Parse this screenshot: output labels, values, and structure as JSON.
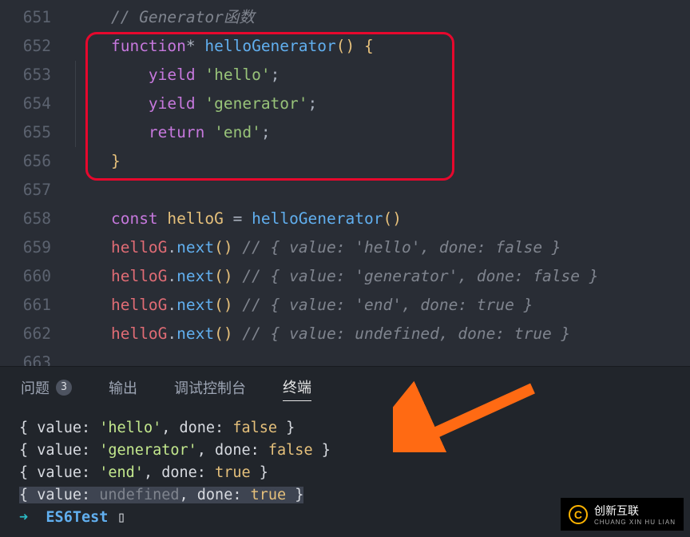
{
  "editor": {
    "lines": [
      {
        "num": "651",
        "tokens": [
          [
            "    ",
            ""
          ],
          [
            "// Generator函数",
            "c-comment"
          ]
        ]
      },
      {
        "num": "652",
        "tokens": [
          [
            "    ",
            ""
          ],
          [
            "function",
            "c-keyword"
          ],
          [
            "* ",
            "c-default"
          ],
          [
            "helloGenerator",
            "c-func"
          ],
          [
            "() ",
            "c-brace"
          ],
          [
            "{",
            "c-brace"
          ]
        ]
      },
      {
        "num": "653",
        "guide": true,
        "tokens": [
          [
            "        ",
            ""
          ],
          [
            "yield",
            "c-keyword"
          ],
          [
            " ",
            "c-default"
          ],
          [
            "'hello'",
            "c-string"
          ],
          [
            ";",
            "c-default"
          ]
        ]
      },
      {
        "num": "654",
        "guide": true,
        "tokens": [
          [
            "        ",
            ""
          ],
          [
            "yield",
            "c-keyword"
          ],
          [
            " ",
            "c-default"
          ],
          [
            "'generator'",
            "c-string"
          ],
          [
            ";",
            "c-default"
          ]
        ]
      },
      {
        "num": "655",
        "guide": true,
        "tokens": [
          [
            "        ",
            ""
          ],
          [
            "return",
            "c-keyword"
          ],
          [
            " ",
            "c-default"
          ],
          [
            "'end'",
            "c-string"
          ],
          [
            ";",
            "c-default"
          ]
        ]
      },
      {
        "num": "656",
        "tokens": [
          [
            "    ",
            ""
          ],
          [
            "}",
            "c-brace"
          ]
        ]
      },
      {
        "num": "657",
        "tokens": [
          [
            "",
            ""
          ]
        ]
      },
      {
        "num": "658",
        "tokens": [
          [
            "    ",
            ""
          ],
          [
            "const",
            "c-keyword"
          ],
          [
            " ",
            "c-default"
          ],
          [
            "helloG",
            "c-const"
          ],
          [
            " = ",
            "c-default"
          ],
          [
            "helloGenerator",
            "c-func"
          ],
          [
            "()",
            "c-brace"
          ]
        ]
      },
      {
        "num": "659",
        "tokens": [
          [
            "    ",
            ""
          ],
          [
            "helloG",
            "c-object"
          ],
          [
            ".",
            "c-default"
          ],
          [
            "next",
            "c-method"
          ],
          [
            "()",
            "c-brace"
          ],
          [
            " ",
            "c-default"
          ],
          [
            "// { value: 'hello', done: false }",
            "c-comment"
          ]
        ]
      },
      {
        "num": "660",
        "tokens": [
          [
            "    ",
            ""
          ],
          [
            "helloG",
            "c-object"
          ],
          [
            ".",
            "c-default"
          ],
          [
            "next",
            "c-method"
          ],
          [
            "()",
            "c-brace"
          ],
          [
            " ",
            "c-default"
          ],
          [
            "// { value: 'generator', done: false }",
            "c-comment"
          ]
        ]
      },
      {
        "num": "661",
        "tokens": [
          [
            "    ",
            ""
          ],
          [
            "helloG",
            "c-object"
          ],
          [
            ".",
            "c-default"
          ],
          [
            "next",
            "c-method"
          ],
          [
            "()",
            "c-brace"
          ],
          [
            " ",
            "c-default"
          ],
          [
            "// { value: 'end', done: true }",
            "c-comment"
          ]
        ]
      },
      {
        "num": "662",
        "tokens": [
          [
            "    ",
            ""
          ],
          [
            "helloG",
            "c-object"
          ],
          [
            ".",
            "c-default"
          ],
          [
            "next",
            "c-method"
          ],
          [
            "()",
            "c-brace"
          ],
          [
            " ",
            "c-default"
          ],
          [
            "// { value: undefined, done: true }",
            "c-comment"
          ]
        ]
      },
      {
        "num": "663",
        "tokens": [
          [
            "",
            ""
          ]
        ]
      }
    ]
  },
  "panel": {
    "tabs": {
      "problems": {
        "label": "问题",
        "badge": "3"
      },
      "output": {
        "label": "输出"
      },
      "debug": {
        "label": "调试控制台"
      },
      "terminal": {
        "label": "终端"
      }
    },
    "terminal": {
      "rows": [
        [
          [
            "{ value: ",
            ""
          ],
          [
            "'hello'",
            "t-string"
          ],
          [
            ", done: ",
            ""
          ],
          [
            "false",
            "t-bool"
          ],
          [
            " }",
            ""
          ]
        ],
        [
          [
            "{ value: ",
            ""
          ],
          [
            "'generator'",
            "t-string"
          ],
          [
            ", done: ",
            ""
          ],
          [
            "false",
            "t-bool"
          ],
          [
            " }",
            ""
          ]
        ],
        [
          [
            "{ value: ",
            ""
          ],
          [
            "'end'",
            "t-string"
          ],
          [
            ", done: ",
            ""
          ],
          [
            "true",
            "t-bool"
          ],
          [
            " }",
            ""
          ]
        ],
        [
          [
            "{ value: ",
            "t-sel"
          ],
          [
            "undefined",
            "t-sel t-undef"
          ],
          [
            ", done: ",
            "t-sel"
          ],
          [
            "true",
            "t-sel t-bool"
          ],
          [
            " }",
            "t-sel"
          ]
        ],
        [
          [
            "➜  ",
            "t-prompt"
          ],
          [
            "ES6Test",
            "t-proj"
          ],
          [
            " ▯",
            ""
          ]
        ]
      ]
    }
  },
  "logo": {
    "text": "创新互联",
    "sub": "CHUANG XIN HU LIAN"
  }
}
